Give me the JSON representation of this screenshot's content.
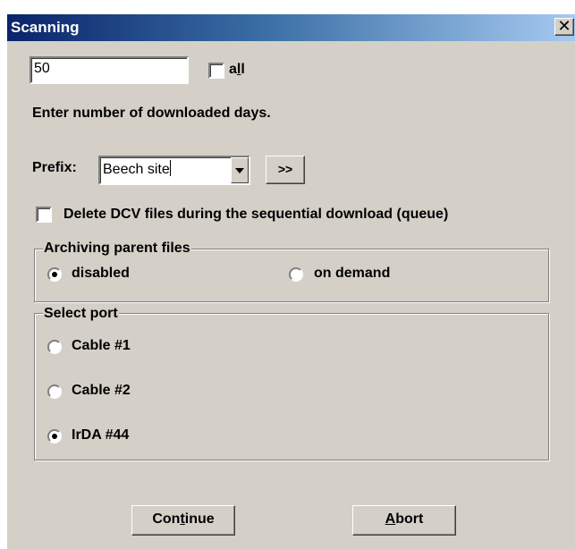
{
  "window": {
    "title": "Scanning",
    "close_glyph": "✕"
  },
  "days": {
    "value": "50",
    "all_label_pre": "a",
    "all_label_mnemonic": "l",
    "all_label_post": "l",
    "all_checked": false,
    "instruction": "Enter number of downloaded days."
  },
  "prefix": {
    "label": "Prefix:",
    "value": "Beech site",
    "more_button": ">>"
  },
  "delete_dcv": {
    "label": "Delete DCV files during the sequential download (queue)",
    "checked": false
  },
  "archiving": {
    "caption": "Archiving parent files",
    "options": [
      {
        "label": "disabled",
        "selected": true
      },
      {
        "label": "on demand",
        "selected": false
      }
    ]
  },
  "port": {
    "caption": "Select port",
    "options": [
      {
        "label": "Cable #1",
        "selected": false
      },
      {
        "label": "Cable #2",
        "selected": false
      },
      {
        "label": "IrDA #44",
        "selected": true
      }
    ]
  },
  "buttons": {
    "continue_pre": "Con",
    "continue_mnemonic": "t",
    "continue_post": "inue",
    "abort_mnemonic": "A",
    "abort_post": "bort"
  }
}
